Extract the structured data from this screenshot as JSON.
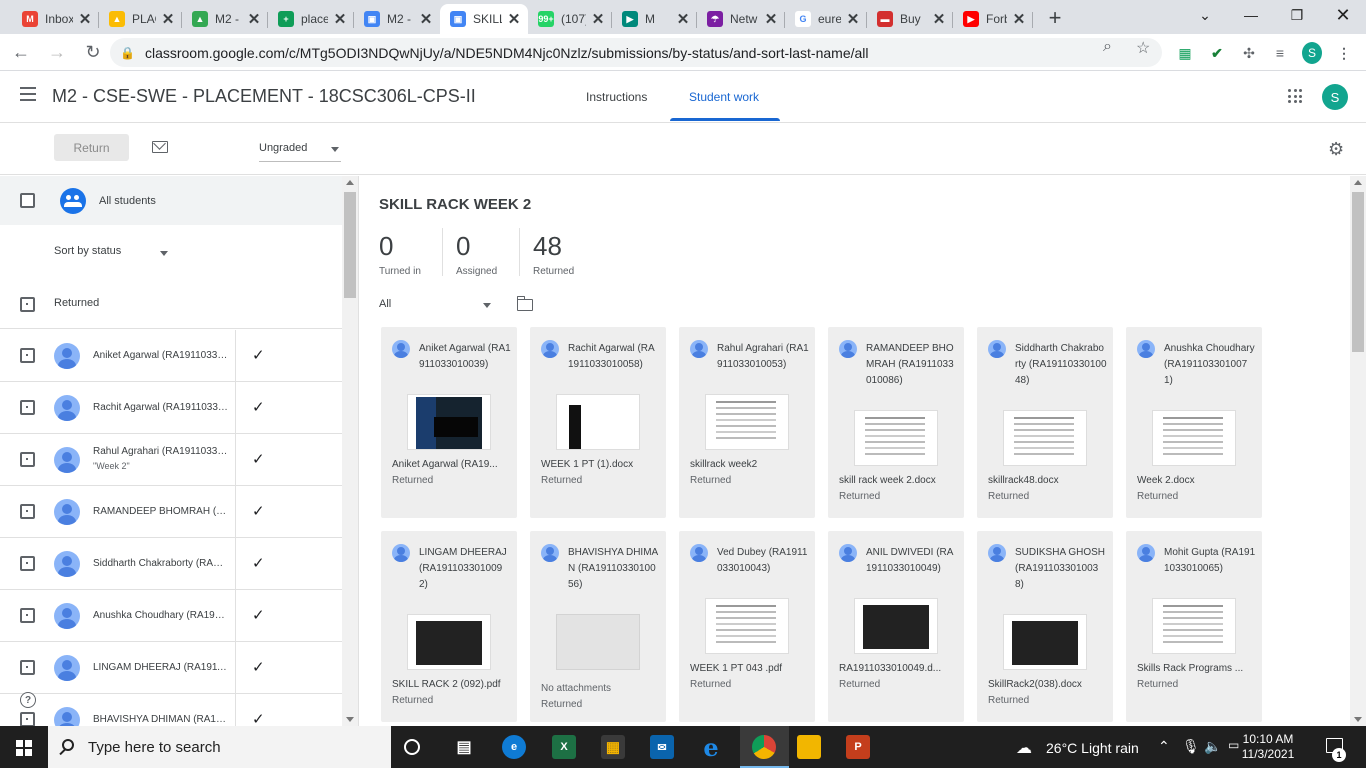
{
  "browser": {
    "tabs": [
      {
        "label": "Inbox",
        "fav_color": "#ea4335",
        "fav_text": "M"
      },
      {
        "label": "PLAC",
        "fav_color": "#fbbc04",
        "fav_text": "▲"
      },
      {
        "label": "M2 -",
        "fav_color": "#34a853",
        "fav_text": "▲"
      },
      {
        "label": "place",
        "fav_color": "#0f9d58",
        "fav_text": "+"
      },
      {
        "label": "M2 -",
        "fav_color": "#4285f4",
        "fav_text": "▣"
      },
      {
        "label": "SKILL",
        "fav_color": "#4285f4",
        "fav_text": "▣"
      },
      {
        "label": "(107)",
        "fav_color": "#25d366",
        "fav_text": "99+"
      },
      {
        "label": "M",
        "fav_color": "#00897b",
        "fav_text": "▶"
      },
      {
        "label": "Netw",
        "fav_color": "#7b1fa2",
        "fav_text": "☂"
      },
      {
        "label": "eurel",
        "fav_color": "#ffffff",
        "fav_text": "G"
      },
      {
        "label": "Buy",
        "fav_color": "#d32f2f",
        "fav_text": "▬"
      },
      {
        "label": "Forb",
        "fav_color": "#ff0000",
        "fav_text": "▶"
      }
    ],
    "new_tab": "+",
    "url": "classroom.google.com/c/MTg5ODI3NDQwNjUy/a/NDE5NDM4Njc0Nzlz/submissions/by-status/and-sort-last-name/all",
    "profile_initial": "S"
  },
  "header": {
    "class_title": "M2 - CSE-SWE - PLACEMENT - 18CSC306L-CPS-II",
    "tab_instructions": "Instructions",
    "tab_student_work": "Student work",
    "account_initial": "S"
  },
  "actions": {
    "return_label": "Return",
    "grade_filter": "Ungraded"
  },
  "sidebar": {
    "all_students": "All students",
    "sort_label": "Sort by status",
    "section_label": "Returned",
    "students": [
      {
        "name": "Aniket Agarwal (RA1911033010039)",
        "sub": ""
      },
      {
        "name": "Rachit Agarwal (RA1911033010058)",
        "sub": ""
      },
      {
        "name": "Rahul Agrahari (RA1911033010053)",
        "sub": "\"Week 2\""
      },
      {
        "name": "RAMANDEEP BHOMRAH (RA1911033010086)",
        "sub": ""
      },
      {
        "name": "Siddharth Chakraborty (RA1911033010048)",
        "sub": ""
      },
      {
        "name": "Anushka Choudhary (RA1911033010071)",
        "sub": ""
      },
      {
        "name": "LINGAM DHEERAJ (RA1911033010092)",
        "sub": ""
      },
      {
        "name": "BHAVISHYA DHIMAN (RA1911033010056)",
        "sub": ""
      }
    ]
  },
  "main": {
    "assignment_title": "SKILL RACK WEEK 2",
    "stats": [
      {
        "value": "0",
        "label": "Turned in"
      },
      {
        "value": "0",
        "label": "Assigned"
      },
      {
        "value": "48",
        "label": "Returned"
      }
    ],
    "filter_label": "All",
    "cards": [
      {
        "name": "Aniket Agarwal (RA1911033010039)",
        "file": "Aniket Agarwal (RA19...",
        "status": "Returned",
        "thumb": "term",
        "name_lines": 3
      },
      {
        "name": "Rachit Agarwal (RA1911033010058)",
        "file": "WEEK 1 PT (1).docx",
        "status": "Returned",
        "thumb": "slim",
        "name_lines": 3
      },
      {
        "name": "Rahul Agrahari (RA1911033010053)",
        "file": "skillrack week2",
        "status": "Returned",
        "thumb": "doc",
        "name_lines": 3
      },
      {
        "name": "RAMANDEEP BHOMRAH (RA1911033010086)",
        "file": "skill rack week 2.docx",
        "status": "Returned",
        "thumb": "doc",
        "name_lines": 4
      },
      {
        "name": "Siddharth Chakraborty (RA1911033010048)",
        "file": "skillrack48.docx",
        "status": "Returned",
        "thumb": "doc",
        "name_lines": 4
      },
      {
        "name": "Anushka Choudhary (RA1911033010071)",
        "file": "Week 2.docx",
        "status": "Returned",
        "thumb": "doc",
        "name_lines": 4
      },
      {
        "name": "LINGAM DHEERAJ (RA1911033010092)",
        "file": "SKILL RACK 2 (092).pdf",
        "status": "Returned",
        "thumb": "dark",
        "name_lines": 4
      },
      {
        "name": "BHAVISHYA DHIMAN (RA1911033010056)",
        "file": "No attachments",
        "status": "Returned",
        "thumb": "empty",
        "name_lines": 4
      },
      {
        "name": "Ved Dubey (RA1911033010043)",
        "file": "WEEK 1 PT 043 .pdf",
        "status": "Returned",
        "thumb": "doc",
        "name_lines": 3
      },
      {
        "name": "ANIL DWIVEDI (RA1911033010049)",
        "file": "RA1911033010049.d...",
        "status": "Returned",
        "thumb": "dark",
        "name_lines": 3
      },
      {
        "name": "SUDIKSHA GHOSH (RA1911033010038)",
        "file": "SkillRack2(038).docx",
        "status": "Returned",
        "thumb": "dark",
        "name_lines": 4
      },
      {
        "name": "Mohit Gupta (RA1911033010065)",
        "file": "Skills Rack Programs ...",
        "status": "Returned",
        "thumb": "doc",
        "name_lines": 3
      }
    ]
  },
  "taskbar": {
    "search_placeholder": "Type here to search",
    "weather": "26°C  Light rain",
    "time": "10:10 AM",
    "date": "11/3/2021",
    "notif_count": "1"
  },
  "colors": {
    "accent": "#1967d2",
    "avatar": "#12a58f"
  }
}
